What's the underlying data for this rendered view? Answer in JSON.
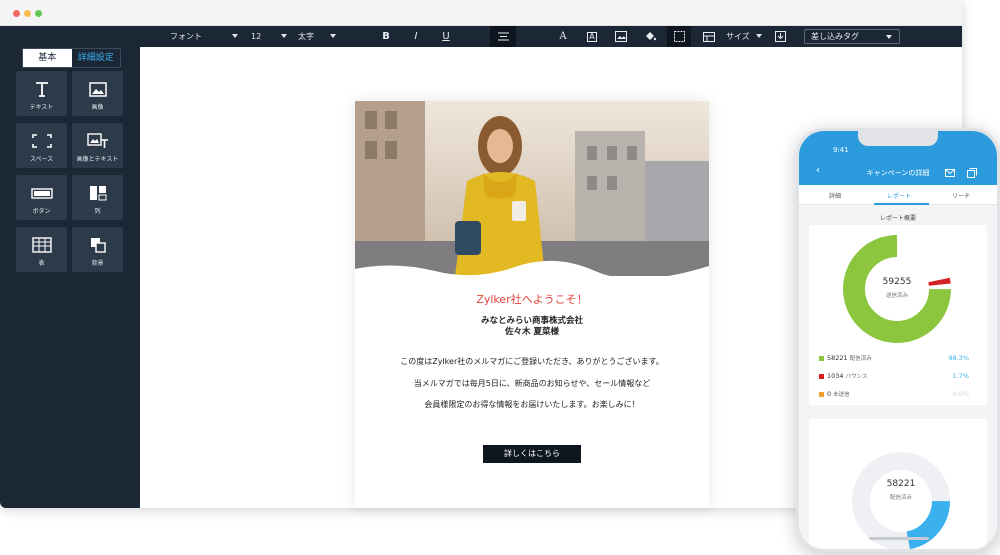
{
  "sidebar": {
    "tabs": [
      {
        "label": "基本"
      },
      {
        "label": "詳細設定"
      }
    ],
    "blocks": [
      {
        "label": "テキスト",
        "icon": "text-icon"
      },
      {
        "label": "画像",
        "icon": "image-icon"
      },
      {
        "label": "スペース",
        "icon": "space-icon"
      },
      {
        "label": "画像とテキスト",
        "icon": "image-text-icon"
      },
      {
        "label": "ボタン",
        "icon": "button-icon"
      },
      {
        "label": "列",
        "icon": "columns-icon"
      },
      {
        "label": "表",
        "icon": "table-icon"
      },
      {
        "label": "背景",
        "icon": "background-icon"
      }
    ]
  },
  "toolbar": {
    "font_label": "フォント",
    "font_size": "12",
    "weight": "太字",
    "bold": "B",
    "italic": "I",
    "underline": "U",
    "size_label": "サイズ",
    "merge_tag": "差し込みタグ"
  },
  "email": {
    "title": "Zylker社へようこそ！",
    "company": "みなとみらい商事株式会社",
    "recipient": "佐々木 夏菜様",
    "line1": "この度はZylker社のメルマガにご登録いただき、ありがとうございます。",
    "line2": "当メルマガでは毎月5日に、新商品のお知らせや、セール情報など",
    "line3": "会員様限定のお得な情報をお届けいたします。お楽しみに！",
    "cta": "詳しくはこちら"
  },
  "phone": {
    "time": "9:41",
    "title": "キャンペーンの詳細",
    "tabs": [
      {
        "label": "詳細"
      },
      {
        "label": "レポート"
      },
      {
        "label": "リーチ"
      }
    ],
    "section": "レポート概要",
    "donut1": {
      "value": "59255",
      "label": "送信済み"
    },
    "legend": [
      {
        "value": "58221",
        "label": "配信済み",
        "pct": "98.3%",
        "color": "#8cc63f",
        "fraction": 0.983
      },
      {
        "value": "1034",
        "label": "バウンス",
        "pct": "1.7%",
        "color": "#d42020",
        "fraction": 0.017
      },
      {
        "value": "0",
        "label": "未送信",
        "pct": "0.0%",
        "color": "#f0a030",
        "fraction": 0.0
      }
    ],
    "donut2": {
      "value": "58221",
      "label": "配信済み"
    }
  },
  "colors": {
    "sidebar_bg": "#1c2735",
    "accent": "#38b1f0",
    "phone_header": "#2c9bde",
    "title_red": "#e0433b",
    "delivered_green": "#8cc63f",
    "opened_blue": "#3ab0ef"
  }
}
